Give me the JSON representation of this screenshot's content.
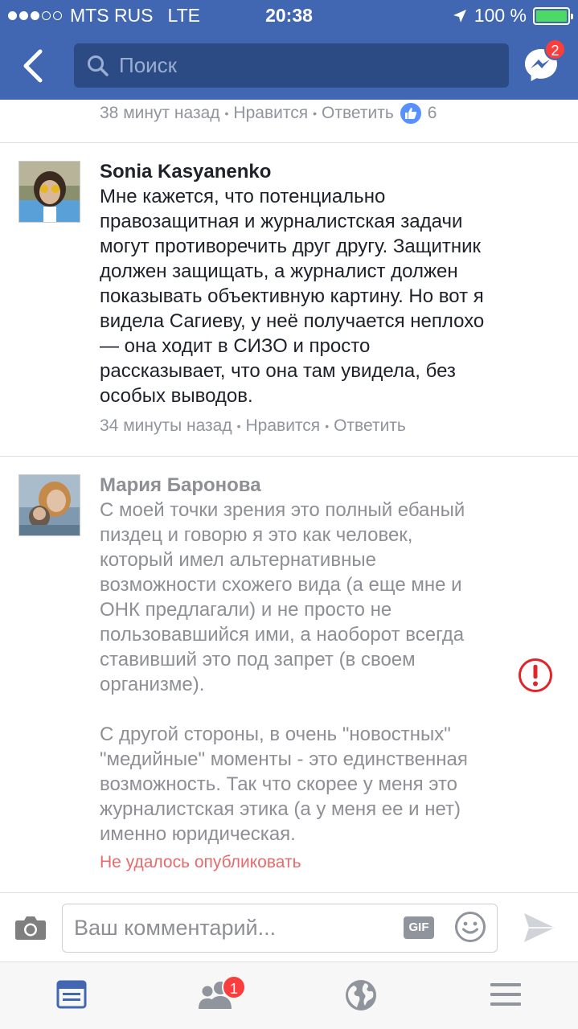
{
  "status_bar": {
    "carrier": "MTS RUS",
    "network": "LTE",
    "time": "20:38",
    "battery": "100 %",
    "signal_bars_filled": 3,
    "signal_bars_total": 5,
    "battery_level": 1.0
  },
  "header": {
    "back_icon": "chevron-left-icon",
    "search_placeholder": "Поиск",
    "messenger_icon": "messenger-icon",
    "messenger_badge": "2"
  },
  "previous_comment": {
    "time": "38 минут назад",
    "like_label": "Нравится",
    "reply_label": "Ответить",
    "like_count": "6"
  },
  "comments": [
    {
      "author": "Sonia Kasyanenko",
      "text": "Мне кажется, что потенциально\nправозащитная и журналистская задачи\nмогут противоречить друг другу. Защитник\nдолжен защищать, а журналист должен\nпоказывать объективную картину. Но вот я\nвидела Сагиеву, у неё получается неплохо\n— она ходит в СИЗО и просто\nрассказывает, что она там увидела, без\nособых выводов.",
      "time": "34 минуты назад",
      "like_label": "Нравится",
      "reply_label": "Ответить"
    },
    {
      "author": "Мария Баронова",
      "lines": [
        "С моей точки зрения это полный ебаный",
        "пиздец и говорю я это как человек,",
        "который имел альтернативные",
        "возможности схожего вида (а еще мне и",
        "ОНК предлагали) и не просто не",
        "пользовавшийся ими, а наоборот всегда",
        "ставивший это под запрет (в своем",
        "организме).",
        "",
        "С другой стороны, в очень \"новостных\"",
        "\"медийные\" моменты - это единственная",
        "возможность. Так что скорее у меня это",
        "журналистская этика (а у меня ее и нет)",
        "именно юридическая."
      ],
      "status": "Не удалось опубликовать"
    }
  ],
  "composer": {
    "placeholder": "Ваш комментарий...",
    "gif_label": "GIF"
  },
  "tabbar": {
    "items": [
      "news-feed-icon",
      "friend-requests-icon",
      "notifications-globe-icon",
      "menu-icon"
    ],
    "friends_badge": "1"
  },
  "colors": {
    "brand": "#4267b2",
    "search_bg": "#2c4a84",
    "badge": "#fa3e3e",
    "failed_text": "#e66b6b"
  }
}
